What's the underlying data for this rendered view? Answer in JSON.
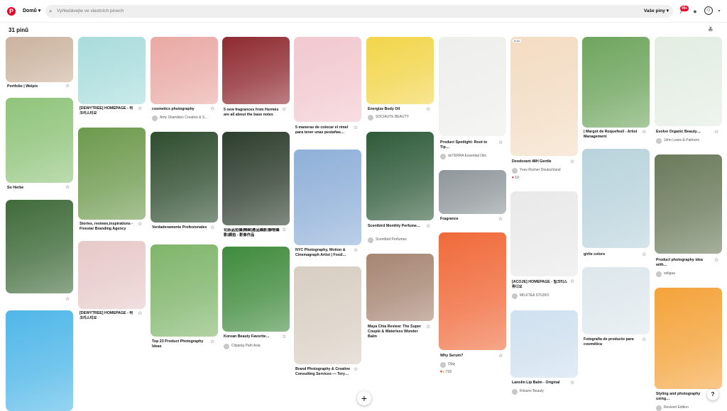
{
  "header": {
    "logo_letter": "P",
    "home_label": "Domů",
    "search_placeholder": "Vyhledávejte ve vlastních pinech",
    "filter_label": "Vaše piny",
    "notif_badge": "99+"
  },
  "pin_count": "31 pinů",
  "pins": {
    "p1": {
      "title": "Portfolio | Welpix",
      "bg": "#cbb39e"
    },
    "p2": {
      "title": "So Herbe",
      "bg": "#8fc47a"
    },
    "p3": {
      "title": "",
      "bg": "#3f6b3a"
    },
    "p4": {
      "title": "",
      "bg": "#4fb7e8"
    },
    "p5": {
      "title": "[DEWYTREE] HOMEPAGE - 뮈 크리스티오",
      "bg": "#a9dcdc"
    },
    "p6": {
      "title": "Stories, reviews,inspirations - Fivestar Branding Agency",
      "bg": "#6d9a4d"
    },
    "p7": {
      "title": "[DEWYTREE] HOMEPAGE - 뮈 크리스티오",
      "bg": "#e7c9c9"
    },
    "p8": {
      "title": "cosmetics photography",
      "source": "Amy Shamblen Creative & S…",
      "bg": "#e9a9a4"
    },
    "p9": {
      "title": "Verdaderamente Profesionales",
      "bg": "#2f4d2f"
    },
    "p10": {
      "title": "Top 23 Product Photography Ideas",
      "bg": "#7fb56a"
    },
    "p11": {
      "title": "5 new fragrances from Hermès are all about the base notes",
      "bg": "#8e2a30"
    },
    "p12": {
      "title": "化妝品拍攝|精緻|產品攝影|靜物攝影|網拍 - 影像作品",
      "bg": "#2d3d2d"
    },
    "p13": {
      "title": "Korean Beauty Favorite…",
      "source": "Clipping Path Asia",
      "bg": "#3f8b3c"
    },
    "p14": {
      "title": "5 maneras de colocar el rímel para tener unas pestañas…",
      "bg": "#f1c8cf"
    },
    "p15": {
      "title": "NYC Photography, Motion & Cinemagraph Artist | Food…",
      "bg": "#8fb0d8"
    },
    "p16": {
      "title": "Brand Photography & Creative Consulting Services — Tery…",
      "bg": "#d8cec2"
    },
    "p17": {
      "title": "Energize Body Oil",
      "source": "SOCIAUTE BEAUTY",
      "bg": "#f2d54a"
    },
    "p18": {
      "title": "Scentbird Monthly Perfume…",
      "source": "Scentbird Perfumes",
      "bg": "#2f5b3a"
    },
    "p19": {
      "title": "Maya Chia Review: The Super Couple & Waterless Wonder Balm",
      "bg": "#a68572"
    },
    "p20": {
      "title": "Product Spotlight: Root to Tip…",
      "source": "doTERRA Essential Oils",
      "bg": "#eeeeec"
    },
    "p21": {
      "title": "Fragrance",
      "bg": "#8f969a"
    },
    "p22": {
      "title": "Why Serum?",
      "source": "Olay",
      "reactions": "718",
      "bg": "#f06a3a"
    },
    "p23": {
      "title": "Deodorant 48H Gentle",
      "source": "Yves Rocher Deutschland",
      "reactions": "10",
      "badge": "0:14",
      "bg": "#f3dcc2"
    },
    "p24": {
      "title": "[ACOJE] HOMEPAGE - 밀크티스튜디오",
      "source": "MILKTEA STUDIO",
      "bg": "#e9e9e9"
    },
    "p25": {
      "title": "Lanolin Lip Balm - Original",
      "source": "Kitoune Beauty",
      "bg": "#cfe0ef"
    },
    "p26": {
      "title": "| Margot de Roquefeuil - Artist Management",
      "bg": "#6ea55d"
    },
    "p27": {
      "title": "girlie colors",
      "bg": "#b9d3dc"
    },
    "p28": {
      "title": "Fotografía de producto para cosmética",
      "bg": "#dde7ec"
    },
    "p29": {
      "title": "Evolve Organic Beauty…",
      "source": "John Lewis & Partners",
      "bg": "#e3ede2"
    },
    "p30": {
      "title": "Product photography idea with…",
      "source": "seligaa",
      "bg": "#6a7a5a"
    },
    "p31": {
      "title": "Styling and photography using…",
      "source": "Revived Edition",
      "bg": "#f4a33a"
    }
  }
}
